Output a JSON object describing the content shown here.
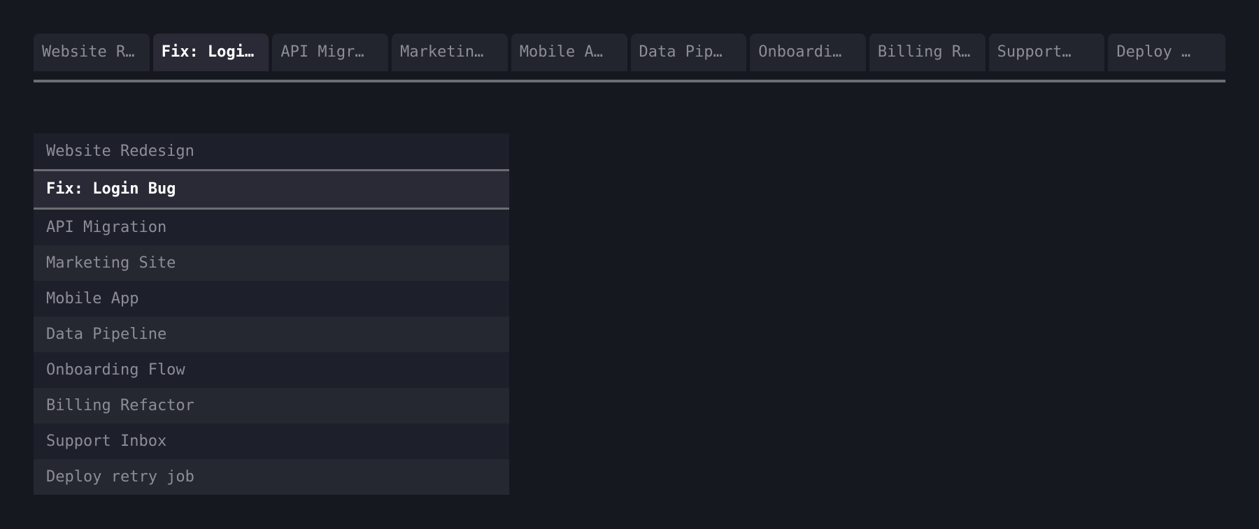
{
  "tabs": [
    {
      "label": "Website Redesign",
      "display": "Website R…"
    },
    {
      "label": "Fix: Login Bug",
      "display": "Fix: Logi…"
    },
    {
      "label": "API Migration",
      "display": "API Migr…"
    },
    {
      "label": "Marketing Site",
      "display": "Marketin…"
    },
    {
      "label": "Mobile App",
      "display": "Mobile A…"
    },
    {
      "label": "Data Pipeline",
      "display": "Data Pip…"
    },
    {
      "label": "Onboarding Flow",
      "display": "Onboardi…"
    },
    {
      "label": "Billing Refactor",
      "display": "Billing R…"
    },
    {
      "label": "Support Inbox",
      "display": "Support…"
    },
    {
      "label": "Deploy retry job",
      "display": "Deploy …"
    }
  ],
  "active_tab_index": 1,
  "list": {
    "items": [
      "Website Redesign",
      "Fix: Login Bug",
      "API Migration",
      "Marketing Site",
      "Mobile App",
      "Data Pipeline",
      "Onboarding Flow",
      "Billing Refactor",
      "Support Inbox",
      "Deploy retry job"
    ]
  },
  "colors": {
    "background": "#161820",
    "tab": "#22242e",
    "active": "#2a2a37",
    "row_odd": "#1d1f2a",
    "row_even": "#252831",
    "divider": "#6c6d73",
    "text": "#8c8d96",
    "active_text": "#ffffff"
  }
}
